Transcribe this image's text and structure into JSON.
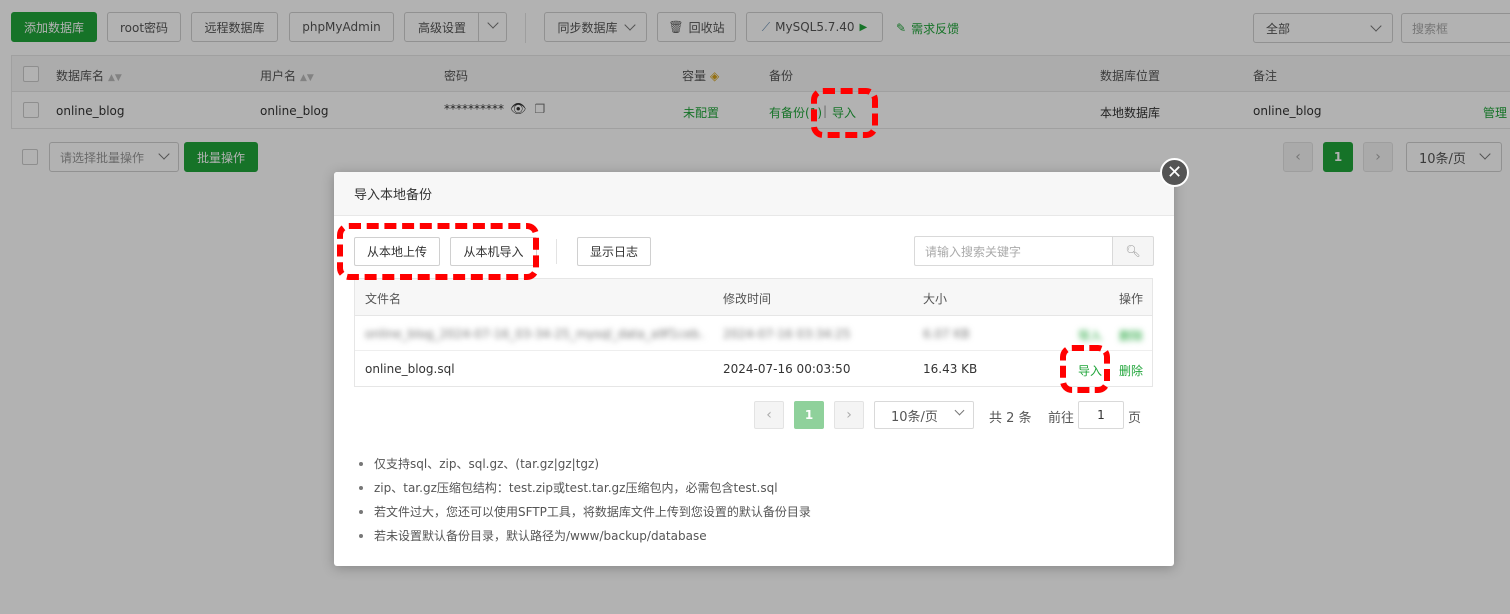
{
  "toolbar": {
    "add_db": "添加数据库",
    "root_pwd": "root密码",
    "remote_db": "远程数据库",
    "phpmyadmin": "phpMyAdmin",
    "advanced": "高级设置",
    "sync_db": "同步数据库",
    "recycle": "回收站",
    "mysql_version": "MySQL5.7.40",
    "feedback": "需求反馈",
    "filter_all": "全部",
    "search_placeholder": "搜索框"
  },
  "table": {
    "headers": {
      "name": "数据库名",
      "user": "用户名",
      "password": "密码",
      "capacity": "容量",
      "backup": "备份",
      "location": "数据库位置",
      "remark": "备注"
    },
    "row": {
      "name": "online_blog",
      "user": "online_blog",
      "password": "**********",
      "capacity": "未配置",
      "backup": "有备份(1)",
      "backup_sep": "|",
      "import": "导入",
      "location": "本地数据库",
      "remark": "online_blog",
      "manage": "管理"
    }
  },
  "batch": {
    "select_placeholder": "请选择批量操作",
    "button": "批量操作"
  },
  "pager": {
    "current": "1",
    "per_page": "10条/页"
  },
  "modal": {
    "title": "导入本地备份",
    "upload_local": "从本地上传",
    "import_local": "从本机导入",
    "show_log": "显示日志",
    "search_placeholder": "请输入搜索关键字",
    "columns": {
      "filename": "文件名",
      "mtime": "修改时间",
      "size": "大小",
      "action": "操作"
    },
    "files": [
      {
        "name": "online_blog_2024-07-16_03-34-25_mysql_data_a9f1ceb…",
        "mtime": "2024-07-16 03:34:25",
        "size": "6.07 KB",
        "import": "导入",
        "delete": "删除"
      },
      {
        "name": "online_blog.sql",
        "mtime": "2024-07-16 00:03:50",
        "size": "16.43 KB",
        "import": "导入",
        "delete": "删除"
      }
    ],
    "pager": {
      "current": "1",
      "per_page": "10条/页",
      "total": "共 2 条",
      "goto_label": "前往",
      "goto_value": "1",
      "page_unit": "页"
    },
    "tips": [
      "仅支持sql、zip、sql.gz、(tar.gz|gz|tgz)",
      "zip、tar.gz压缩包结构：test.zip或test.tar.gz压缩包内，必需包含test.sql",
      "若文件过大，您还可以使用SFTP工具，将数据库文件上传到您设置的默认备份目录",
      "若未设置默认备份目录，默认路径为/www/backup/database"
    ]
  },
  "colors": {
    "accent": "#20a53a",
    "annotation": "#ff0000"
  }
}
